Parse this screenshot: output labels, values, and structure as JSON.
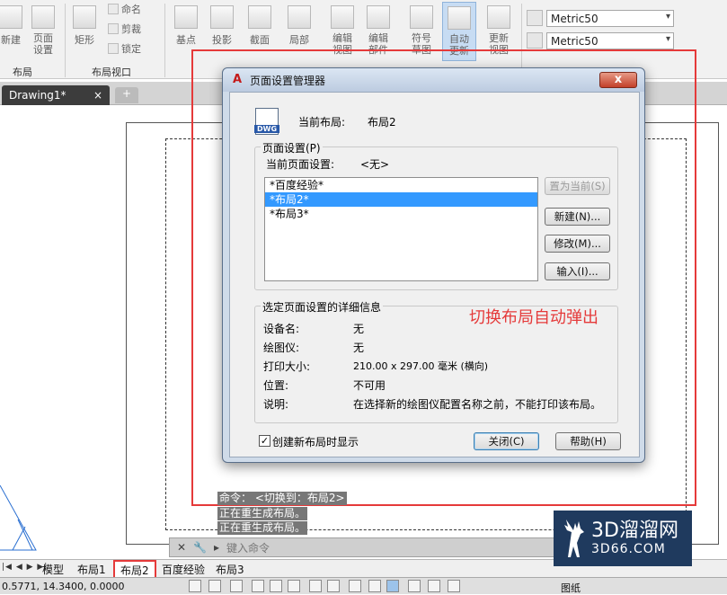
{
  "ribbon": {
    "buttons_left": [
      "新建",
      "页面\n设置",
      "矩形",
      "基点",
      "投影",
      "截面",
      "局部",
      "编辑\n视图",
      "编辑\n部件",
      "符号\n草图",
      "自动\n更新",
      "更新\n视图"
    ],
    "small_items": [
      "命名",
      "剪裁",
      "锁定"
    ],
    "panels": [
      "布局",
      "布局视口"
    ],
    "combo1": "Metric50",
    "combo2": "Metric50"
  },
  "tabs": {
    "drawing": "Drawing1*",
    "close_glyph": "×",
    "new_glyph": "+"
  },
  "command": {
    "line1": "命令：  <切换到：布局2>",
    "line2": "正在重生成布局。",
    "line3": "正在重生成布局。",
    "prompt": "键入命令"
  },
  "layout_tabs": {
    "nav": "|◀ ◀ ▶ ▶|",
    "model": "模型",
    "b1": "布局1",
    "b2": "布局2",
    "baidu": "百度经验",
    "b3": "布局3"
  },
  "status": {
    "coords": "0.5771, 14.3400, 0.0000",
    "paper": "图纸"
  },
  "dialog": {
    "title": "页面设置管理器",
    "logo": "A",
    "close": "x",
    "current_layout_label": "当前布局:",
    "current_layout_value": "布局2",
    "dwg_label": "DWG",
    "setup_group": "页面设置(P)",
    "current_setup_label": "当前页面设置:",
    "current_setup_value": "<无>",
    "setups": [
      "*百度经验*",
      "*布局2*",
      "*布局3*"
    ],
    "btn_set_current": "置为当前(S)",
    "btn_new": "新建(N)...",
    "btn_modify": "修改(M)...",
    "btn_import": "输入(I)...",
    "details_group": "选定页面设置的详细信息",
    "details": [
      {
        "label": "设备名:",
        "value": "无"
      },
      {
        "label": "绘图仪:",
        "value": "无"
      },
      {
        "label": "打印大小:",
        "value": "210.00 x 297.00 毫米 (横向)"
      },
      {
        "label": "位置:",
        "value": "不可用"
      },
      {
        "label": "说明:",
        "value": "在选择新的绘图仪配置名称之前，不能打印该布局。"
      }
    ],
    "checkbox_label": "创建新布局时显示",
    "btn_close": "关闭(C)",
    "btn_help": "帮助(H)"
  },
  "annotation": "切换布局自动弹出",
  "watermark": {
    "title": "3D溜溜网",
    "sub": "3D66.COM"
  }
}
